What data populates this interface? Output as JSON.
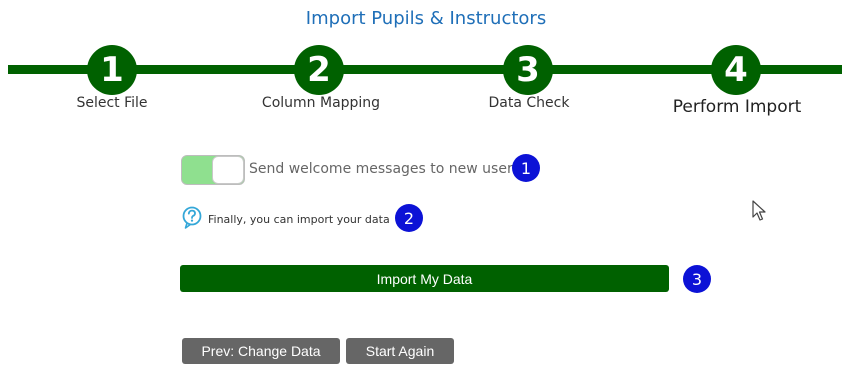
{
  "title": "Import Pupils & Instructors",
  "steps": [
    {
      "number": "1",
      "label": "Select File"
    },
    {
      "number": "2",
      "label": "Column Mapping"
    },
    {
      "number": "3",
      "label": "Data Check"
    },
    {
      "number": "4",
      "label": "Perform Import"
    }
  ],
  "toggle": {
    "label": "Send welcome messages to new users",
    "state": "on"
  },
  "help": {
    "text": "Finally, you can import your data"
  },
  "import_button": {
    "label": "Import My Data"
  },
  "buttons": {
    "prev": "Prev: Change Data",
    "start_again": "Start Again"
  },
  "badges": [
    "1",
    "2",
    "3"
  ],
  "colors": {
    "accent": "#006100",
    "title": "#1f6fb8",
    "badge": "#0c12d6",
    "toggle_on": "#8fe08f"
  }
}
